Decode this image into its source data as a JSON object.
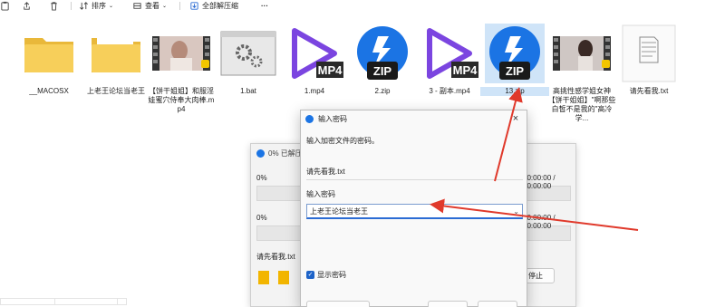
{
  "toolbar": {
    "sort_label": "排序",
    "view_label": "查看",
    "extract_all_label": "全部解压缩",
    "more_label": "···"
  },
  "files": [
    {
      "name": "__MACOSX",
      "type": "folder"
    },
    {
      "name": "上老王论坛当老王",
      "type": "folder"
    },
    {
      "name": "【饼干姐姐】和服淫娃蜜穴侍奉大肉棒.mp4",
      "type": "video-thumb"
    },
    {
      "name": "1.bat",
      "type": "bat"
    },
    {
      "name": "1.mp4",
      "type": "mp4",
      "badge": "MP4"
    },
    {
      "name": "2.zip",
      "type": "zip",
      "badge": "ZIP"
    },
    {
      "name": "3 - 副本.mp4",
      "type": "mp4",
      "badge": "MP4"
    },
    {
      "name": "13.zip",
      "type": "zip",
      "badge": "ZIP"
    },
    {
      "name": "高挑性感学姐女神【饼干姐姐】\"啊那些白皙不是我的\"高冷学...",
      "type": "video-thumb"
    },
    {
      "name": "请先看我.txt",
      "type": "txt"
    }
  ],
  "progress_dialog": {
    "title": "0% 已解压",
    "percent_1": "0%",
    "percent_2": "0%",
    "time_1": "00:00:00 / 00:00:00",
    "time_2": "00:00:00 / 00:00:00",
    "current_file": "请先看我.txt",
    "stop_label": "停止"
  },
  "password_dialog": {
    "title": "输入密码",
    "prompt": "输入加密文件的密码。",
    "file_name": "请先看我.txt",
    "password_label": "输入密码",
    "password_value": "上老王论坛当老王",
    "show_password_label": "显示密码",
    "show_password_checked": true
  },
  "colors": {
    "accent": "#2b6cd4",
    "arrow": "#e0392b",
    "folder": "#f4c542",
    "mp4_purple": "#7b45e0",
    "zip_blue": "#1b74e4"
  }
}
